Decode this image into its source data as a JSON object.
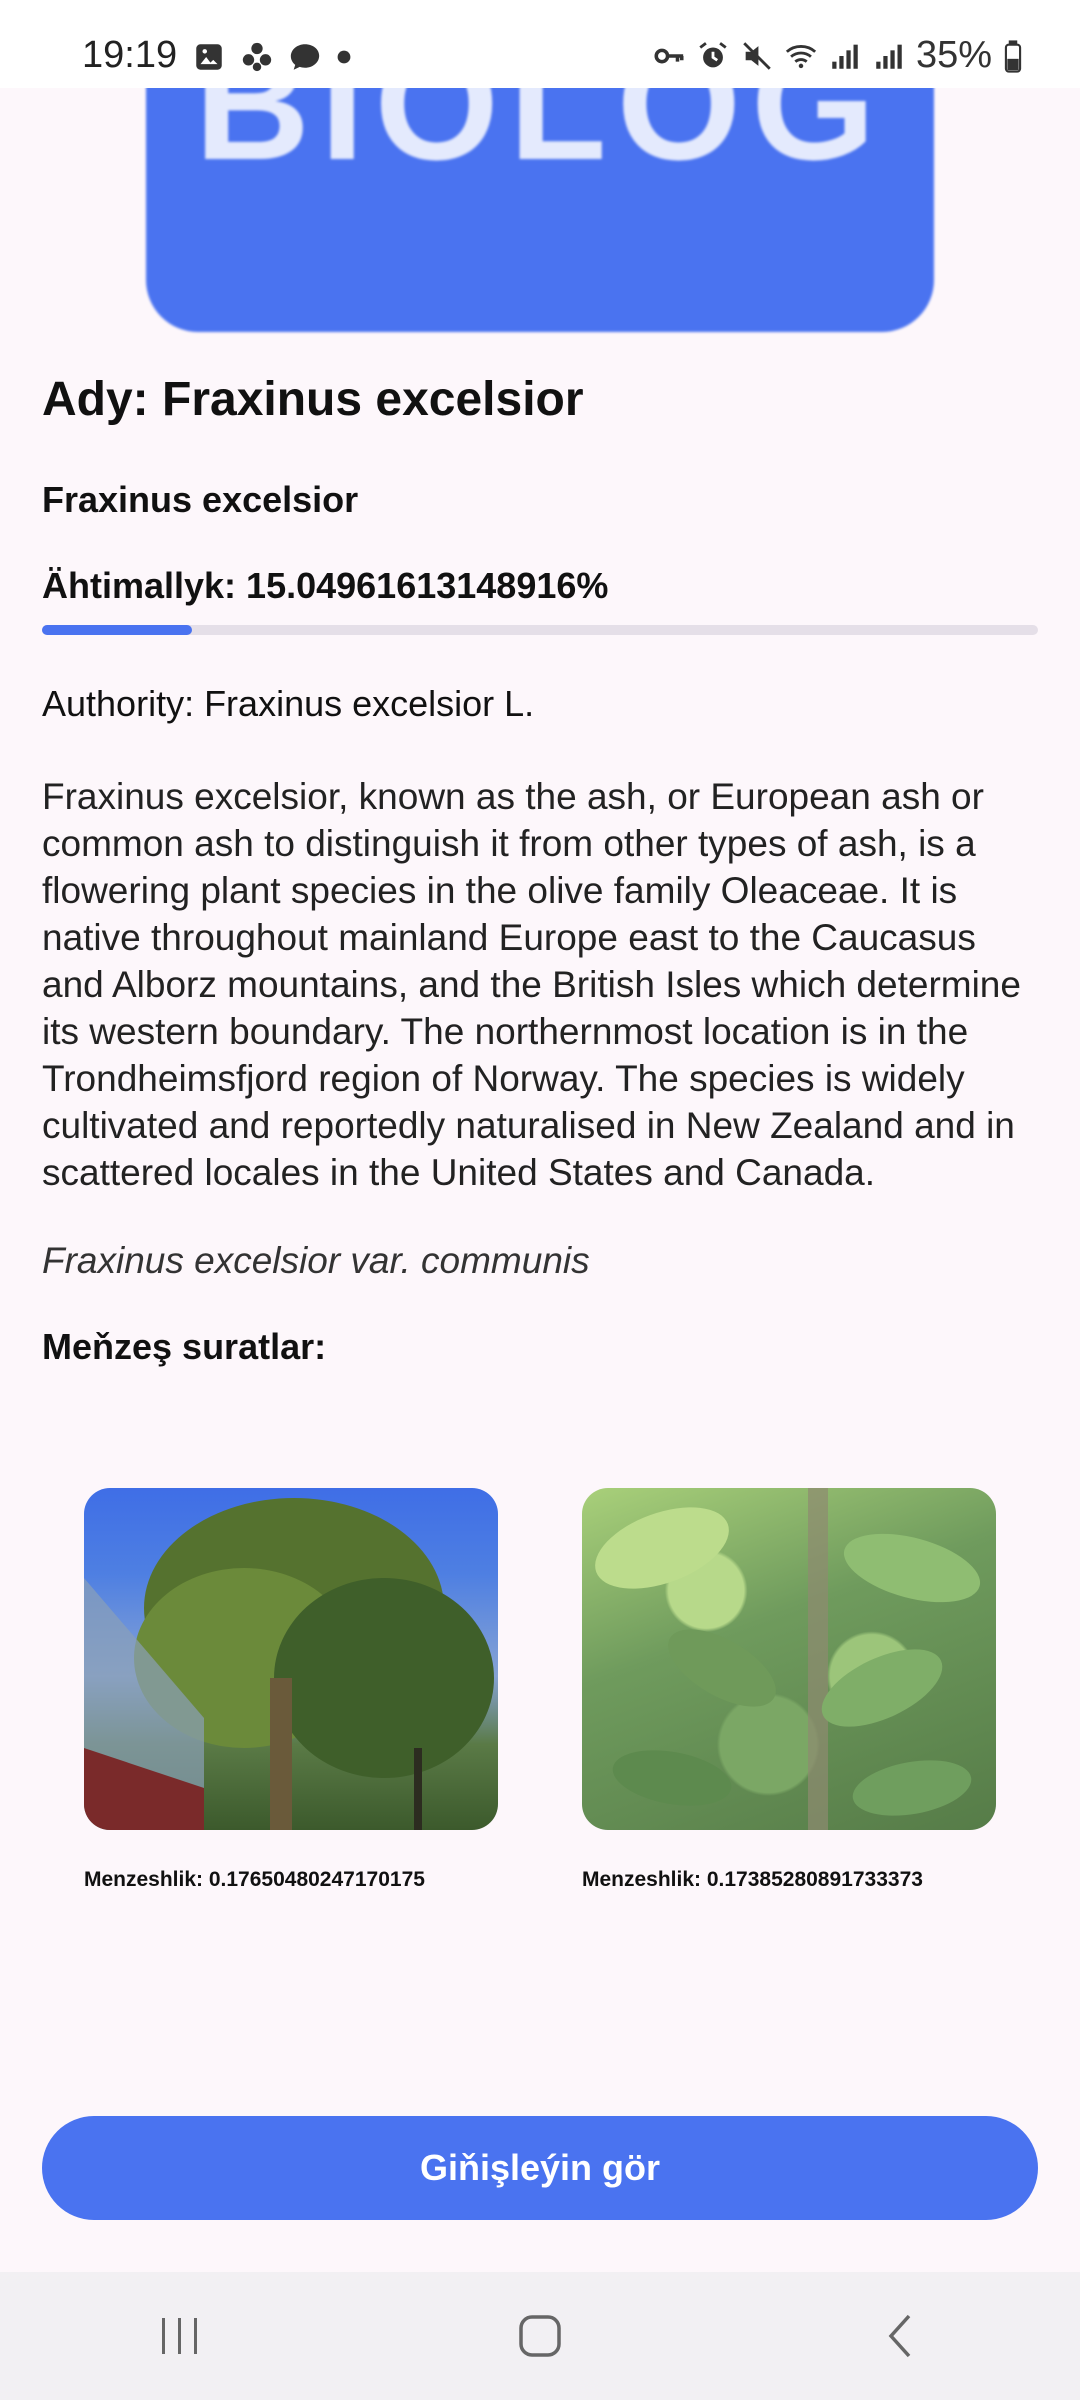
{
  "status_bar": {
    "time": "19:19",
    "battery": "35%"
  },
  "banner": {
    "text": "BIOLOG",
    "color": "#4a73f0"
  },
  "species": {
    "title": "Ady: Fraxinus excelsior",
    "name": "Fraxinus excelsior",
    "probability_text": "Ähtimallyk: 15.04961613148916%",
    "probability": 0.1504961613148916,
    "authority": "Authority: Fraxinus excelsior L.",
    "description": "Fraxinus excelsior, known as the ash, or European ash or common ash to distinguish it from other types of ash, is a flowering plant species in the olive family Oleaceae. It is native throughout mainland Europe east to the Caucasus and Alborz mountains, and the British Isles which determine its western boundary. The northernmost location is in the Trondheimsfjord region of Norway. The species is widely cultivated and reportedly naturalised in New Zealand and in scattered locales in the United States and Canada.",
    "synonym": "Fraxinus excelsior var. communis"
  },
  "similar": {
    "title": "Meňzeş suratlar:",
    "images": [
      {
        "caption": "Menzeshlik: 0.17650480247170175"
      },
      {
        "caption": "Menzeshlik: 0.17385280891733373"
      }
    ]
  },
  "actions": {
    "expand_label": "Giňişleýin gör"
  }
}
